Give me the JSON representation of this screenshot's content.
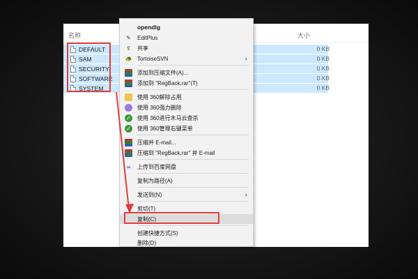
{
  "explorer": {
    "col_name": "名称",
    "col_size": "大小",
    "files": [
      {
        "name": "DEFAULT",
        "size": "0 KB"
      },
      {
        "name": "SAM",
        "size": "0 KB"
      },
      {
        "name": "SECURITY",
        "size": "0 KB"
      },
      {
        "name": "SOFTWARE",
        "size": "0 KB"
      },
      {
        "name": "SYSTEM",
        "size": "0 KB"
      }
    ]
  },
  "menu": {
    "items": [
      {
        "label": "opendlg",
        "icon": "none"
      },
      {
        "label": "EditPlus",
        "icon": "editplus-icon"
      },
      {
        "label": "共享",
        "icon": "share-icon"
      },
      {
        "label": "TortoiseSVN",
        "icon": "svn-icon",
        "submenu": true
      },
      {
        "label": "添加到压缩文件(A)...",
        "icon": "winrar-icon"
      },
      {
        "label": "添加到 \"RegBack.rar\"(T)",
        "icon": "winrar-icon"
      },
      {
        "label": "使用 360解除占用",
        "icon": "360-unlock-icon"
      },
      {
        "label": "使用 360强力删除",
        "icon": "360-delete-icon"
      },
      {
        "label": "使用 360进行木马云查杀",
        "icon": "360-scan-icon"
      },
      {
        "label": "使用 360管理右键菜单",
        "icon": "360-menu-icon"
      },
      {
        "label": "压缩并 E-mail...",
        "icon": "winrar-icon"
      },
      {
        "label": "压缩到 \"RegBack.rar\" 并 E-mail",
        "icon": "winrar-icon"
      },
      {
        "label": "上传到百度网盘",
        "icon": "baidu-cloud-icon"
      },
      {
        "label": "复制为路径(A)",
        "icon": "none"
      },
      {
        "label": "发送到(N)",
        "icon": "none",
        "submenu": true
      },
      {
        "label": "剪切(T)",
        "icon": "none"
      },
      {
        "label": "复制(C)",
        "icon": "none"
      },
      {
        "label": "创建快捷方式(S)",
        "icon": "none"
      },
      {
        "label": "删除(D)",
        "icon": "none"
      }
    ]
  },
  "colors": {
    "annotation_red": "#e23b3b",
    "selection_blue": "#cce8ff"
  }
}
